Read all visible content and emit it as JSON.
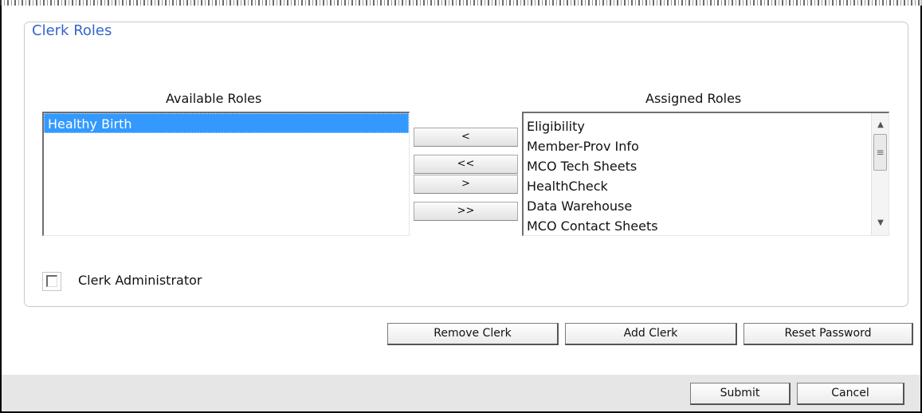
{
  "section": {
    "title": "Clerk Roles"
  },
  "available": {
    "label": "Available Roles",
    "items": [
      "Healthy Birth"
    ],
    "selected_index": 0
  },
  "assigned": {
    "label": "Assigned Roles",
    "items": [
      "Eligibility",
      "Member-Prov Info",
      "MCO Tech Sheets",
      "HealthCheck",
      "Data Warehouse",
      "MCO Contact Sheets"
    ]
  },
  "move_buttons": {
    "move_left": "<",
    "move_all_left": "<<",
    "move_right": ">",
    "move_all_right": ">>"
  },
  "admin_checkbox": {
    "label": "Clerk Administrator",
    "checked": false
  },
  "actions": {
    "remove_clerk": "Remove Clerk",
    "add_clerk": "Add Clerk",
    "reset_password": "Reset Password"
  },
  "footer": {
    "submit": "Submit",
    "cancel": "Cancel"
  },
  "icons": {
    "scroll_up": "scroll-up-arrow-icon",
    "scroll_down": "scroll-down-arrow-icon",
    "scroll_grip": "scroll-grip-icon"
  },
  "colors": {
    "legend": "#3366cc",
    "selection": "#3399ff",
    "footer_bg": "#e6e6e6"
  }
}
